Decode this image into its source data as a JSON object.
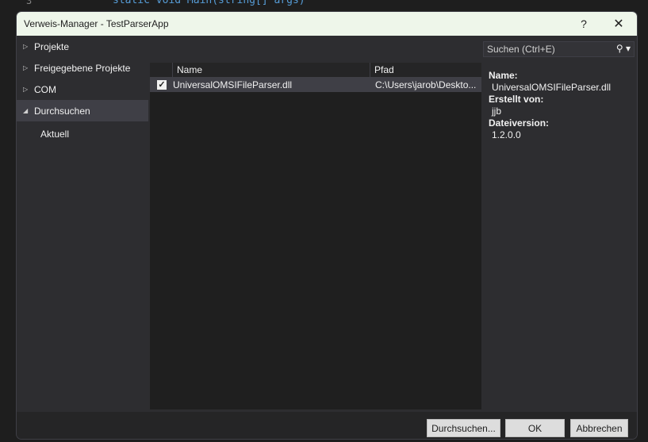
{
  "background": {
    "code_line": "static void Main(string[] args)",
    "line_number": "3"
  },
  "dialog": {
    "title": "Verweis-Manager - TestParserApp",
    "help_label": "?",
    "close_label": "✕"
  },
  "nav": {
    "items": [
      {
        "label": "Projekte",
        "arrow": "▷"
      },
      {
        "label": "Freigegebene Projekte",
        "arrow": "▷"
      },
      {
        "label": "COM",
        "arrow": "▷"
      },
      {
        "label": "Durchsuchen",
        "arrow": "◢"
      },
      {
        "label": "Aktuell"
      }
    ]
  },
  "grid": {
    "columns": [
      "Name",
      "Pfad"
    ],
    "rows": [
      {
        "checked": true,
        "name": "UniversalOMSIFileParser.dll",
        "path": "C:\\Users\\jarob\\Deskto..."
      }
    ]
  },
  "search": {
    "placeholder": "Suchen (Ctrl+E)",
    "icon": "search-icon"
  },
  "details": {
    "name_label": "Name:",
    "name": "UniversalOMSIFileParser.dll",
    "author_label": "Erstellt von:",
    "author": "jjb",
    "version_label": "Dateiversion:",
    "version": "1.2.0.0"
  },
  "footer": {
    "browse": "Durchsuchen...",
    "ok": "OK",
    "cancel": "Abbrechen"
  }
}
